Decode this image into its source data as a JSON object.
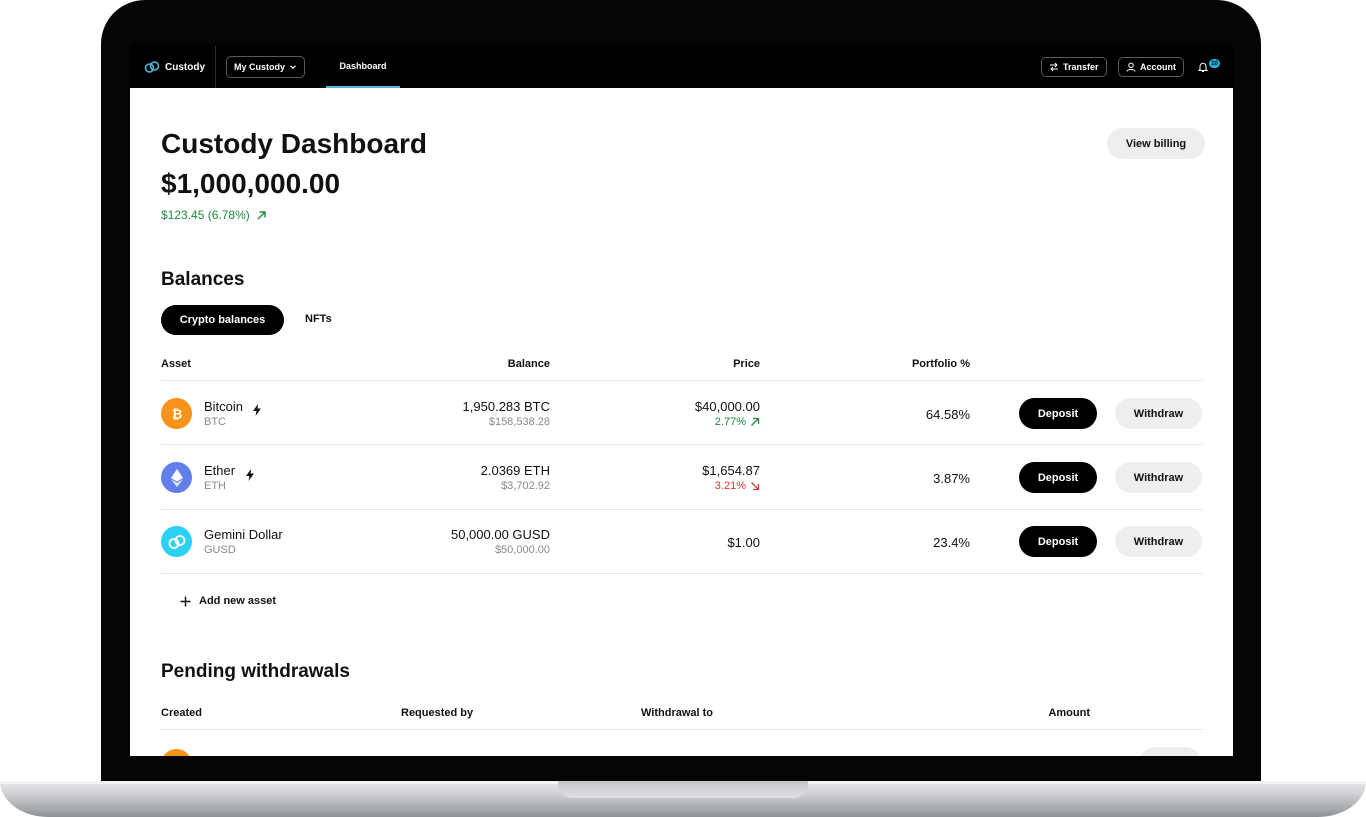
{
  "topbar": {
    "brand": "Custody",
    "scope_select": "My Custody",
    "active_tab": "Dashboard",
    "transfer": "Transfer",
    "account": "Account",
    "notification_count": "10"
  },
  "header": {
    "title": "Custody Dashboard",
    "total": "$1,000,000.00",
    "change": "$123.45 (6.78%)",
    "view_billing": "View billing"
  },
  "balances": {
    "title": "Balances",
    "tabs": [
      "Crypto balances",
      "NFTs"
    ],
    "columns": {
      "asset": "Asset",
      "balance": "Balance",
      "price": "Price",
      "portfolio": "Portfolio %"
    },
    "rows": [
      {
        "name": "Bitcoin",
        "symbol": "BTC",
        "balance": "1,950.283 BTC",
        "balance_usd": "$158,538.28",
        "price": "$40,000.00",
        "price_change": "2.77%",
        "trend": "up",
        "portfolio": "64.58%",
        "deposit": "Deposit",
        "withdraw": "Withdraw",
        "color": "#f7931a"
      },
      {
        "name": "Ether",
        "symbol": "ETH",
        "balance": "2.0369 ETH",
        "balance_usd": "$3,702.92",
        "price": "$1,654.87",
        "price_change": "3.21%",
        "trend": "down",
        "portfolio": "3.87%",
        "deposit": "Deposit",
        "withdraw": "Withdraw",
        "color": "#627eea"
      },
      {
        "name": "Gemini Dollar",
        "symbol": "GUSD",
        "balance": "50,000.00 GUSD",
        "balance_usd": "$50,000.00",
        "price": "$1.00",
        "price_change": "",
        "trend": "none",
        "portfolio": "23.4%",
        "deposit": "Deposit",
        "withdraw": "Withdraw",
        "color": "#2ad1f5"
      }
    ],
    "add_asset": "Add new asset"
  },
  "pending": {
    "title": "Pending withdrawals",
    "columns": {
      "created": "Created",
      "requested_by": "Requested by",
      "withdrawal_to": "Withdrawal to",
      "amount": "Amount"
    }
  },
  "colors": {
    "accent": "#4fb8d8",
    "positive": "#1f8a3c",
    "negative": "#d23a3a",
    "badge": "#1fb3e0"
  }
}
